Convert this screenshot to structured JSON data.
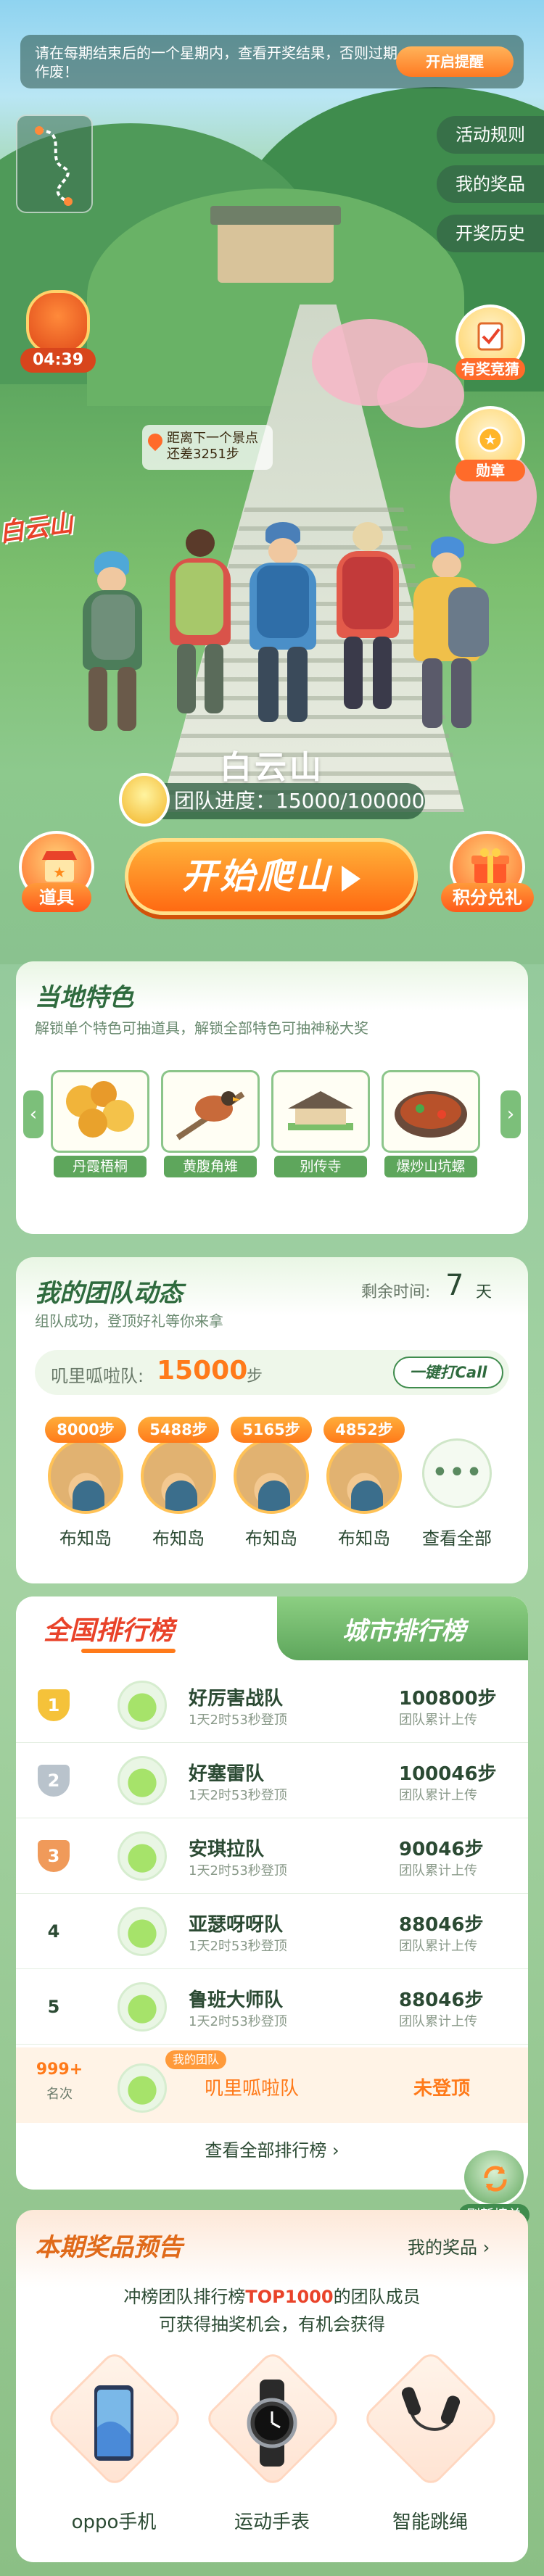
{
  "notice": {
    "text": "请在每期结束后的一个星期内，查看开奖结果，否则过期作废！",
    "button": "开启提醒"
  },
  "side_menu": [
    "活动规则",
    "我的奖品",
    "开奖历史"
  ],
  "timer": "04:39",
  "next_spot": {
    "line1": "距离下一个景点",
    "line2": "还差3251步"
  },
  "sign_text": "白云山",
  "badges": {
    "guess": "有奖竞猜",
    "medal": "勋章"
  },
  "mountain": {
    "name": "白云山",
    "progress_label": "团队进度：",
    "progress_value": 15000,
    "progress_total": 100000,
    "progress_text": "15000/100000"
  },
  "actions": {
    "left_label": "道具",
    "main_button": "开始爬山",
    "right_label": "积分兑礼"
  },
  "local_features": {
    "title": "当地特色",
    "subtitle": "解锁单个特色可抽道具，解锁全部特色可抽神秘大奖",
    "items": [
      {
        "label": "丹霞梧桐"
      },
      {
        "label": "黄腹角雉"
      },
      {
        "label": "别传寺"
      },
      {
        "label": "爆炒山坑螺"
      }
    ]
  },
  "team": {
    "title": "我的团队动态",
    "remaining_label": "剩余时间:",
    "remaining_value": "7",
    "remaining_unit": "天",
    "subtitle": "组队成功，登顶好礼等你来拿",
    "team_name": "叽里呱啦队:",
    "team_steps": "15000",
    "team_steps_unit": "步",
    "call_button": "一键打Call",
    "members": [
      {
        "steps": "8000步",
        "name": "布知岛"
      },
      {
        "steps": "5488步",
        "name": "布知岛"
      },
      {
        "steps": "5165步",
        "name": "布知岛"
      },
      {
        "steps": "4852步",
        "name": "布知岛"
      }
    ],
    "view_all": "查看全部"
  },
  "ranking": {
    "tab_national": "全国排行榜",
    "tab_city": "城市排行榜",
    "rows": [
      {
        "rank": "1",
        "team": "好厉害战队",
        "time": "1天2时53秒登顶",
        "steps": "100800步",
        "note": "团队累计上传"
      },
      {
        "rank": "2",
        "team": "好塞雷队",
        "time": "1天2时53秒登顶",
        "steps": "100046步",
        "note": "团队累计上传"
      },
      {
        "rank": "3",
        "team": "安琪拉队",
        "time": "1天2时53秒登顶",
        "steps": "90046步",
        "note": "团队累计上传"
      },
      {
        "rank": "4",
        "team": "亚瑟呀呀队",
        "time": "1天2时53秒登顶",
        "steps": "88046步",
        "note": "团队累计上传"
      },
      {
        "rank": "5",
        "team": "鲁班大师队",
        "time": "1天2时53秒登顶",
        "steps": "88046步",
        "note": "团队累计上传"
      }
    ],
    "mine": {
      "rank": "999+",
      "rank_label": "名次",
      "tag": "我的团队",
      "team": "叽里呱啦队",
      "status": "未登顶"
    },
    "view_all": "查看全部排行榜",
    "refresh": "刷新榜单"
  },
  "prizes": {
    "title": "本期奖品预告",
    "my_prizes": "我的奖品",
    "desc_prefix": "冲榜团队排行榜",
    "desc_highlight": "TOP1000",
    "desc_suffix": "的团队成员",
    "desc_line2": "可获得抽奖机会，有机会获得",
    "items": [
      {
        "name": "oppo手机"
      },
      {
        "name": "运动手表"
      },
      {
        "name": "智能跳绳"
      }
    ]
  },
  "colors": {
    "accent_orange": "#ff7a1a",
    "brand_green": "#2f6b3e",
    "highlight_red": "#e9432a"
  }
}
